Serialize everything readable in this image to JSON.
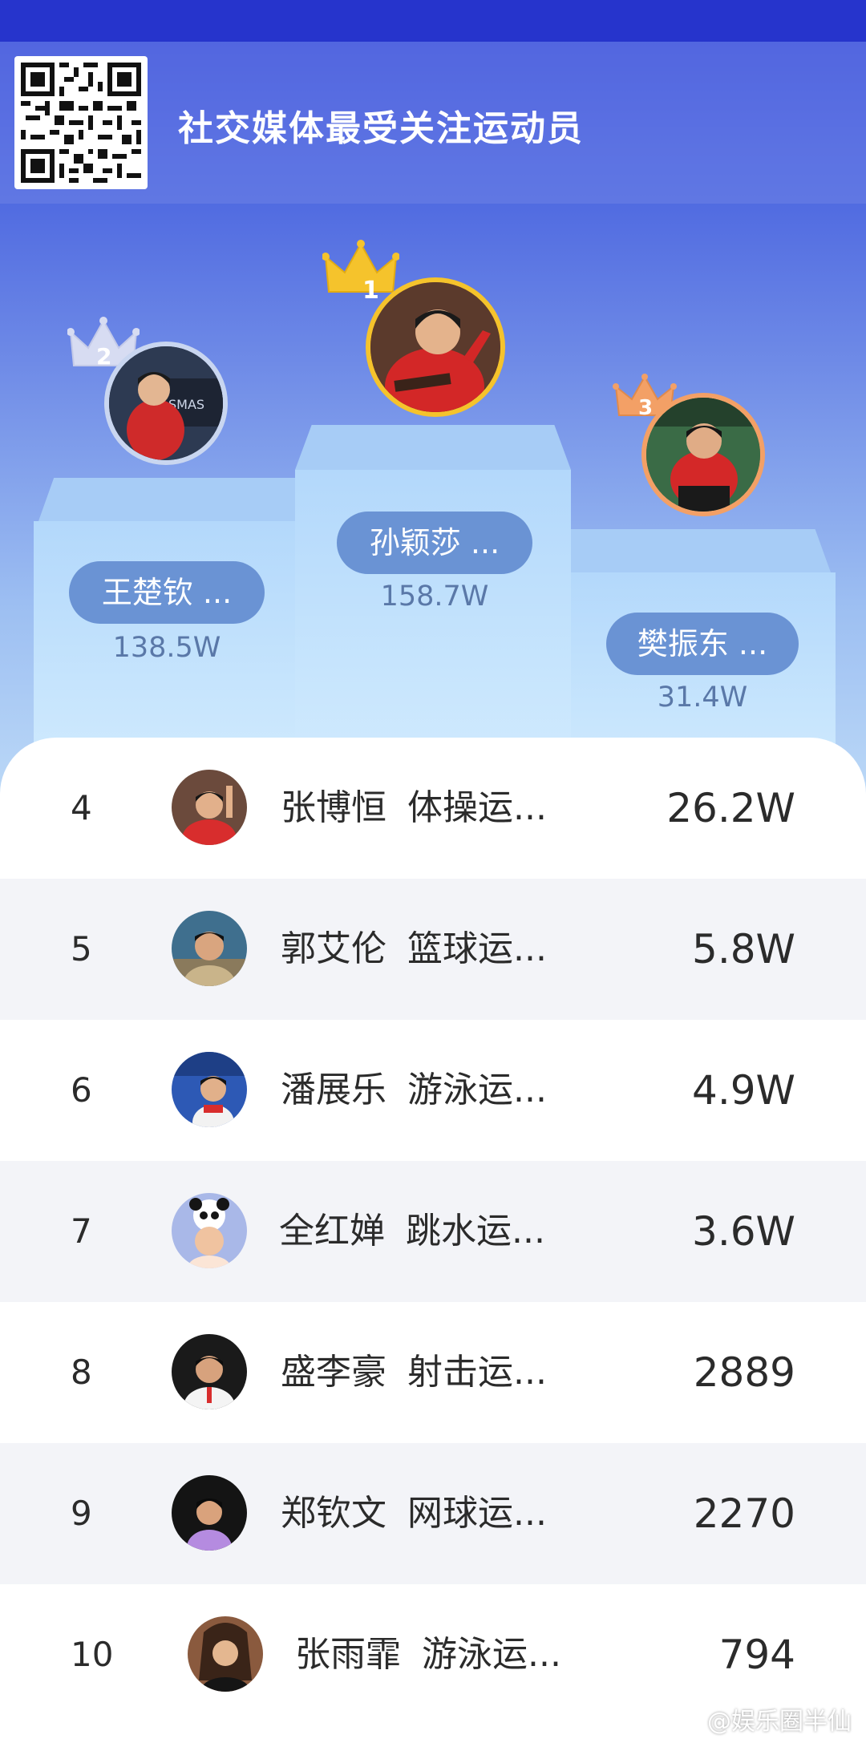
{
  "header": {
    "title": "社交媒体最受关注运动员",
    "qr_icon": "qr-code-icon"
  },
  "podium": {
    "first": {
      "rank": "1",
      "name": "孙颖莎 ...",
      "score": "158.7W",
      "crown_color": "#f5c32c"
    },
    "second": {
      "rank": "2",
      "name": "王楚钦 ...",
      "score": "138.5W",
      "crown_color": "#d7dcf2"
    },
    "third": {
      "rank": "3",
      "name": "樊振东 ...",
      "score": "31.4W",
      "crown_color": "#f3a066"
    }
  },
  "list": [
    {
      "rank": "4",
      "name": "张博恒",
      "desc": "体操运...",
      "count": "26.2W"
    },
    {
      "rank": "5",
      "name": "郭艾伦",
      "desc": "篮球运...",
      "count": "5.8W"
    },
    {
      "rank": "6",
      "name": "潘展乐",
      "desc": "游泳运...",
      "count": "4.9W"
    },
    {
      "rank": "7",
      "name": "全红婵",
      "desc": "跳水运...",
      "count": "3.6W"
    },
    {
      "rank": "8",
      "name": "盛李豪",
      "desc": "射击运...",
      "count": "2889"
    },
    {
      "rank": "9",
      "name": "郑钦文",
      "desc": "网球运...",
      "count": "2270"
    },
    {
      "rank": "10",
      "name": "张雨霏",
      "desc": "游泳运...",
      "count": "794"
    }
  ],
  "watermark": "@娱乐圈半仙",
  "colors": {
    "accent": "#2634cc",
    "pill": "#6a93d4",
    "gold": "#f5c32c",
    "bronze": "#f3a066"
  }
}
